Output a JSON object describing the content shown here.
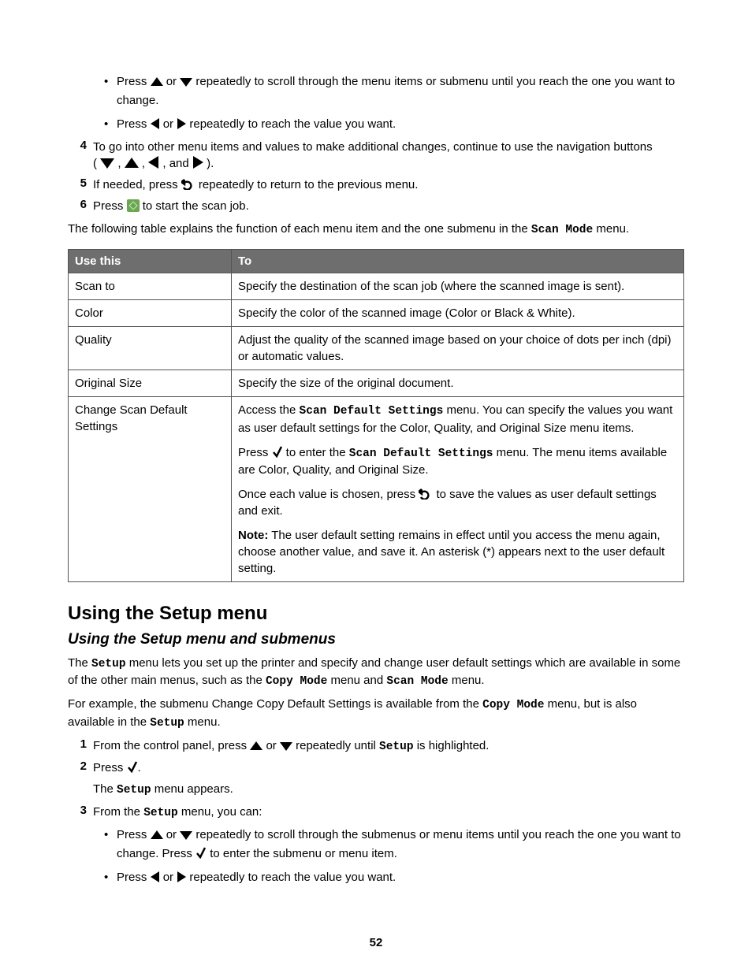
{
  "topList": {
    "bulletA": {
      "pre": "Press ",
      "mid": " or ",
      "post": " repeatedly to scroll through the menu items or submenu until you reach the one you want to change."
    },
    "bulletB": {
      "pre": "Press ",
      "mid": " or ",
      "post": " repeatedly to reach the value you want."
    },
    "item4": {
      "num": "4",
      "line1_pre": "To go into other menu items and values to make additional changes, continue to use the navigation buttons",
      "paren_open": "(",
      "sep1": ", ",
      "sep2": ", ",
      "sep3": ", and ",
      "paren_close": ")."
    },
    "item5": {
      "num": "5",
      "pre": "If needed, press ",
      "post": " repeatedly to return to the previous menu."
    },
    "item6": {
      "num": "6",
      "pre": "Press ",
      "post": " to start the scan job."
    }
  },
  "tableIntro": {
    "pre": "The following table explains the function of each menu item and the one submenu in the ",
    "mono": "Scan Mode",
    "post": " menu."
  },
  "table": {
    "h1": "Use this",
    "h2": "To",
    "rows": [
      {
        "c1": "Scan to",
        "c2": "Specify the destination of the scan job (where the scanned image is sent)."
      },
      {
        "c1": "Color",
        "c2": "Specify the color of the scanned image (Color or Black & White)."
      },
      {
        "c1": "Quality",
        "c2": "Adjust the quality of the scanned image based on your choice of dots per inch (dpi) or automatic values."
      },
      {
        "c1": "Original Size",
        "c2": "Specify the size of the original document."
      }
    ],
    "row5": {
      "c1": "Change Scan Default Settings",
      "p1_pre": "Access the ",
      "p1_mono": "Scan Default Settings",
      "p1_post": " menu. You can specify the values you want as user default settings for the Color, Quality, and Original Size menu items.",
      "p2_pre": "Press ",
      "p2_mid": " to enter the ",
      "p2_mono": "Scan Default Settings",
      "p2_post": " menu. The menu items available are Color, Quality, and Original Size.",
      "p3_pre": "Once each value is chosen, press ",
      "p3_post": " to save the values as user default settings and exit.",
      "p4_note": "Note:",
      "p4_text": " The user default setting remains in effect until you access the menu again, choose another value, and save it. An asterisk (*) appears next to the user default setting."
    }
  },
  "h1": "Using the Setup menu",
  "h2": "Using the Setup menu and submenus",
  "p1": {
    "seg1": "The ",
    "m1": "Setup",
    "seg2": " menu lets you set up the printer and specify and change user default settings which are available in some of the other main menus, such as the ",
    "m2": "Copy Mode",
    "seg3": " menu and ",
    "m3": "Scan Mode",
    "seg4": " menu."
  },
  "p2": {
    "seg1": "For example, the submenu Change Copy Default Settings is available from the ",
    "m1": "Copy Mode",
    "seg2": " menu, but is also available in the ",
    "m2": "Setup",
    "seg3": " menu."
  },
  "steps": {
    "s1": {
      "num": "1",
      "pre": "From the control panel, press ",
      "mid": " or ",
      "post_pre": " repeatedly until ",
      "mono": "Setup",
      "post_post": " is highlighted."
    },
    "s2": {
      "num": "2",
      "pre": "Press ",
      "post": ".",
      "sub_pre": "The ",
      "sub_mono": "Setup",
      "sub_post": " menu appears."
    },
    "s3": {
      "num": "3",
      "pre": "From the ",
      "mono": "Setup",
      "post": " menu, you can:",
      "b1_pre": "Press ",
      "b1_mid": " or ",
      "b1_post1": " repeatedly to scroll through the submenus or menu items until you reach the one you want to change. Press ",
      "b1_post2": " to enter the submenu or menu item.",
      "b2_pre": "Press ",
      "b2_mid": " or ",
      "b2_post": " repeatedly to reach the value you want."
    }
  },
  "pageNumber": "52"
}
